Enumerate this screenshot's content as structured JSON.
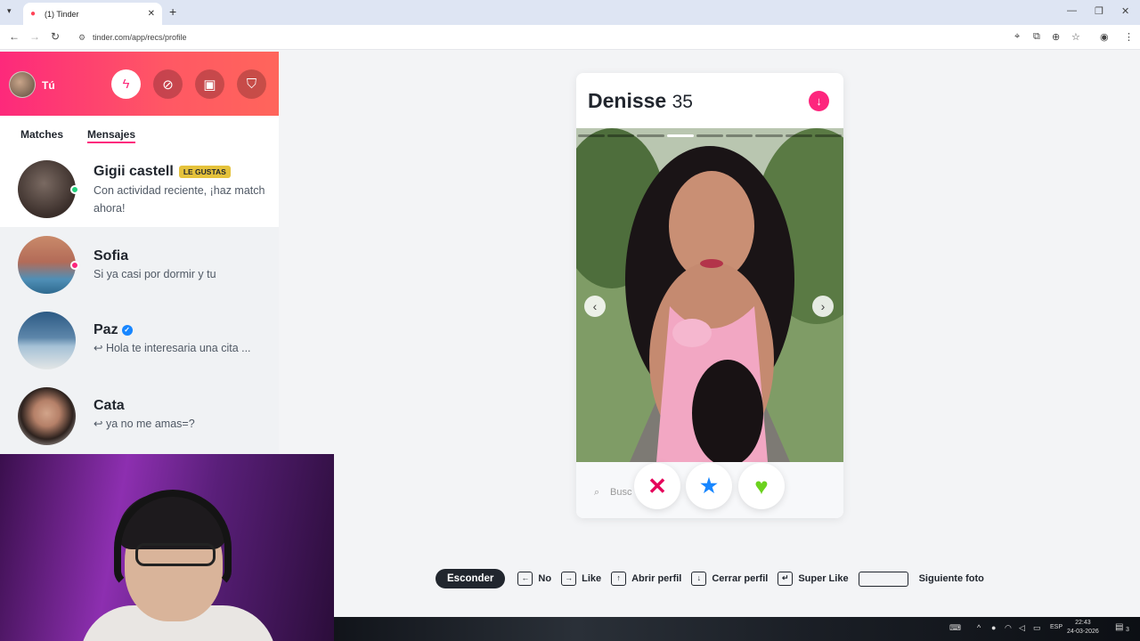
{
  "browser": {
    "tab_title": "(1) Tinder",
    "url": "tinder.com/app/recs/profile",
    "new_tab_symbol": "+"
  },
  "sidebar": {
    "me_label": "Tú",
    "tabs": [
      "Matches",
      "Mensajes"
    ],
    "conversations": [
      {
        "name": "Gigii castell",
        "badge": "LE GUSTAS",
        "message": "Con actividad reciente, ¡haz match ahora!",
        "status_color": "#21d07c"
      },
      {
        "name": "Sofia",
        "message": "Si ya casi por dormir y tu",
        "status_color": "#fd267d"
      },
      {
        "name": "Paz",
        "verified": true,
        "message": "↩ Hola te interesaria una cita ..."
      },
      {
        "name": "Cata",
        "message": "↩ ya no me amas=?"
      }
    ]
  },
  "profile": {
    "name": "Denisse",
    "age": "35",
    "photo_count": 9,
    "current_photo": 4,
    "search_placeholder": "Busc"
  },
  "shortcuts": {
    "hide_label": "Esconder",
    "items": [
      {
        "key": "←",
        "label": "No"
      },
      {
        "key": "→",
        "label": "Like"
      },
      {
        "key": "↑",
        "label": "Abrir perfil"
      },
      {
        "key": "↓",
        "label": "Cerrar perfil"
      },
      {
        "key": "↵",
        "label": "Super Like"
      },
      {
        "key": "",
        "label": "Siguiente foto"
      }
    ]
  },
  "taskbar": {
    "lang": "ESP",
    "time": "22:43",
    "date": "24-03-2026",
    "notifications": "3"
  },
  "colors": {
    "brand_gradient_start": "#fd297b",
    "brand_gradient_end": "#ff655b",
    "nope": "#e5005a",
    "superlike": "#1786ff",
    "like": "#6bd21e"
  }
}
